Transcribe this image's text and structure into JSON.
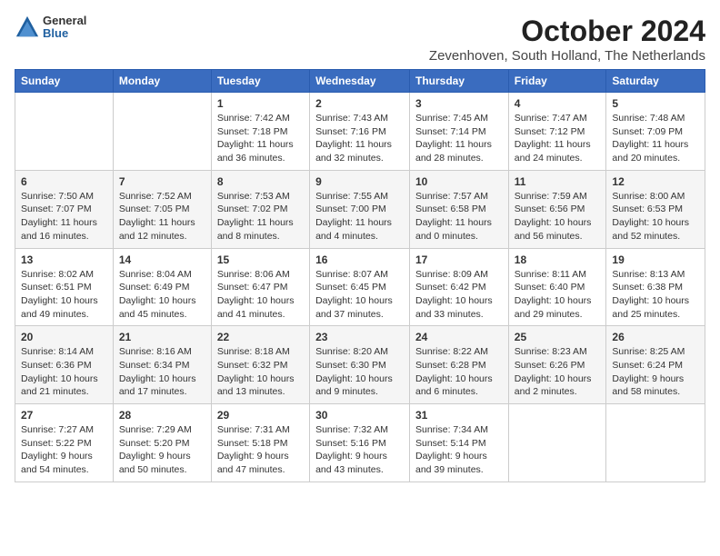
{
  "header": {
    "logo_general": "General",
    "logo_blue": "Blue",
    "month_year": "October 2024",
    "location": "Zevenhoven, South Holland, The Netherlands"
  },
  "days_of_week": [
    "Sunday",
    "Monday",
    "Tuesday",
    "Wednesday",
    "Thursday",
    "Friday",
    "Saturday"
  ],
  "weeks": [
    [
      {
        "day": "",
        "info": ""
      },
      {
        "day": "",
        "info": ""
      },
      {
        "day": "1",
        "info": "Sunrise: 7:42 AM\nSunset: 7:18 PM\nDaylight: 11 hours and 36 minutes."
      },
      {
        "day": "2",
        "info": "Sunrise: 7:43 AM\nSunset: 7:16 PM\nDaylight: 11 hours and 32 minutes."
      },
      {
        "day": "3",
        "info": "Sunrise: 7:45 AM\nSunset: 7:14 PM\nDaylight: 11 hours and 28 minutes."
      },
      {
        "day": "4",
        "info": "Sunrise: 7:47 AM\nSunset: 7:12 PM\nDaylight: 11 hours and 24 minutes."
      },
      {
        "day": "5",
        "info": "Sunrise: 7:48 AM\nSunset: 7:09 PM\nDaylight: 11 hours and 20 minutes."
      }
    ],
    [
      {
        "day": "6",
        "info": "Sunrise: 7:50 AM\nSunset: 7:07 PM\nDaylight: 11 hours and 16 minutes."
      },
      {
        "day": "7",
        "info": "Sunrise: 7:52 AM\nSunset: 7:05 PM\nDaylight: 11 hours and 12 minutes."
      },
      {
        "day": "8",
        "info": "Sunrise: 7:53 AM\nSunset: 7:02 PM\nDaylight: 11 hours and 8 minutes."
      },
      {
        "day": "9",
        "info": "Sunrise: 7:55 AM\nSunset: 7:00 PM\nDaylight: 11 hours and 4 minutes."
      },
      {
        "day": "10",
        "info": "Sunrise: 7:57 AM\nSunset: 6:58 PM\nDaylight: 11 hours and 0 minutes."
      },
      {
        "day": "11",
        "info": "Sunrise: 7:59 AM\nSunset: 6:56 PM\nDaylight: 10 hours and 56 minutes."
      },
      {
        "day": "12",
        "info": "Sunrise: 8:00 AM\nSunset: 6:53 PM\nDaylight: 10 hours and 52 minutes."
      }
    ],
    [
      {
        "day": "13",
        "info": "Sunrise: 8:02 AM\nSunset: 6:51 PM\nDaylight: 10 hours and 49 minutes."
      },
      {
        "day": "14",
        "info": "Sunrise: 8:04 AM\nSunset: 6:49 PM\nDaylight: 10 hours and 45 minutes."
      },
      {
        "day": "15",
        "info": "Sunrise: 8:06 AM\nSunset: 6:47 PM\nDaylight: 10 hours and 41 minutes."
      },
      {
        "day": "16",
        "info": "Sunrise: 8:07 AM\nSunset: 6:45 PM\nDaylight: 10 hours and 37 minutes."
      },
      {
        "day": "17",
        "info": "Sunrise: 8:09 AM\nSunset: 6:42 PM\nDaylight: 10 hours and 33 minutes."
      },
      {
        "day": "18",
        "info": "Sunrise: 8:11 AM\nSunset: 6:40 PM\nDaylight: 10 hours and 29 minutes."
      },
      {
        "day": "19",
        "info": "Sunrise: 8:13 AM\nSunset: 6:38 PM\nDaylight: 10 hours and 25 minutes."
      }
    ],
    [
      {
        "day": "20",
        "info": "Sunrise: 8:14 AM\nSunset: 6:36 PM\nDaylight: 10 hours and 21 minutes."
      },
      {
        "day": "21",
        "info": "Sunrise: 8:16 AM\nSunset: 6:34 PM\nDaylight: 10 hours and 17 minutes."
      },
      {
        "day": "22",
        "info": "Sunrise: 8:18 AM\nSunset: 6:32 PM\nDaylight: 10 hours and 13 minutes."
      },
      {
        "day": "23",
        "info": "Sunrise: 8:20 AM\nSunset: 6:30 PM\nDaylight: 10 hours and 9 minutes."
      },
      {
        "day": "24",
        "info": "Sunrise: 8:22 AM\nSunset: 6:28 PM\nDaylight: 10 hours and 6 minutes."
      },
      {
        "day": "25",
        "info": "Sunrise: 8:23 AM\nSunset: 6:26 PM\nDaylight: 10 hours and 2 minutes."
      },
      {
        "day": "26",
        "info": "Sunrise: 8:25 AM\nSunset: 6:24 PM\nDaylight: 9 hours and 58 minutes."
      }
    ],
    [
      {
        "day": "27",
        "info": "Sunrise: 7:27 AM\nSunset: 5:22 PM\nDaylight: 9 hours and 54 minutes."
      },
      {
        "day": "28",
        "info": "Sunrise: 7:29 AM\nSunset: 5:20 PM\nDaylight: 9 hours and 50 minutes."
      },
      {
        "day": "29",
        "info": "Sunrise: 7:31 AM\nSunset: 5:18 PM\nDaylight: 9 hours and 47 minutes."
      },
      {
        "day": "30",
        "info": "Sunrise: 7:32 AM\nSunset: 5:16 PM\nDaylight: 9 hours and 43 minutes."
      },
      {
        "day": "31",
        "info": "Sunrise: 7:34 AM\nSunset: 5:14 PM\nDaylight: 9 hours and 39 minutes."
      },
      {
        "day": "",
        "info": ""
      },
      {
        "day": "",
        "info": ""
      }
    ]
  ]
}
